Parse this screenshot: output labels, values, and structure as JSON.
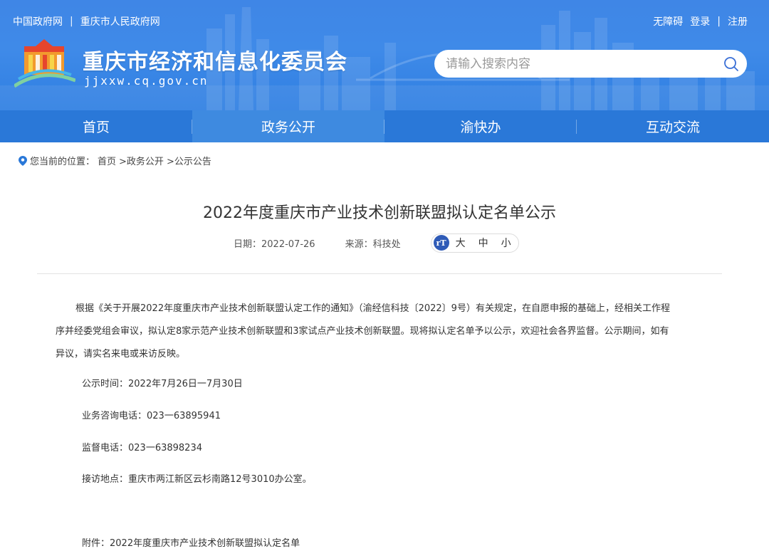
{
  "top_links": {
    "gov_cn": "中国政府网",
    "separator": "|",
    "cq_gov": "重庆市人民政府网"
  },
  "top_right": {
    "accessibility": "无障碍",
    "login": "登录",
    "separator": "|",
    "register": "注册"
  },
  "site": {
    "title": "重庆市经济和信息化委员会",
    "domain": "jjxxw.cq.gov.cn"
  },
  "search": {
    "placeholder": "请输入搜索内容"
  },
  "nav": {
    "items": [
      {
        "label": "首页"
      },
      {
        "label": "政务公开"
      },
      {
        "label": "渝快办"
      },
      {
        "label": "互动交流"
      }
    ],
    "active_index": 1
  },
  "breadcrumb": {
    "prefix": "您当前的位置：",
    "items": [
      "首页",
      ">政务公开",
      ">公示公告"
    ]
  },
  "article": {
    "title": "2022年度重庆市产业技术创新联盟拟认定名单公示",
    "date": "日期：2022-07-26",
    "source": "来源：科技处",
    "font_size": {
      "badge": "rT",
      "large": "大",
      "medium": "中",
      "small": "小"
    },
    "paragraph_lines": [
      "根据《关于开展2022年度重庆市产业技术创新联盟认定工作的通知》（渝经信科技〔2022〕9号）有关规定，在自愿申报的基础上，经相关工作程",
      "序并经委党组会审议，拟认定8家示范产业技术创新联盟和3家试点产业技术创新联盟。现将拟认定名单予以公示，欢迎社会各界监督。公示期间，如有",
      "异议，请实名来电或来访反映。"
    ],
    "notice_period": "公示时间：2022年7月26日一7月30日",
    "consult_phone": "业务咨询电话：023一63895941",
    "supervise_phone": "监督电话：023一63898234",
    "address": "接访地点：重庆市两江新区云杉南路12号3010办公室。",
    "attachment": "附件：2022年度重庆市产业技术创新联盟拟认定名单"
  },
  "colors": {
    "header_blue": "#3f86e6",
    "nav_blue": "#2a78d8",
    "nav_active": "#3e8ae0",
    "badge_blue": "#2f5bb7"
  }
}
